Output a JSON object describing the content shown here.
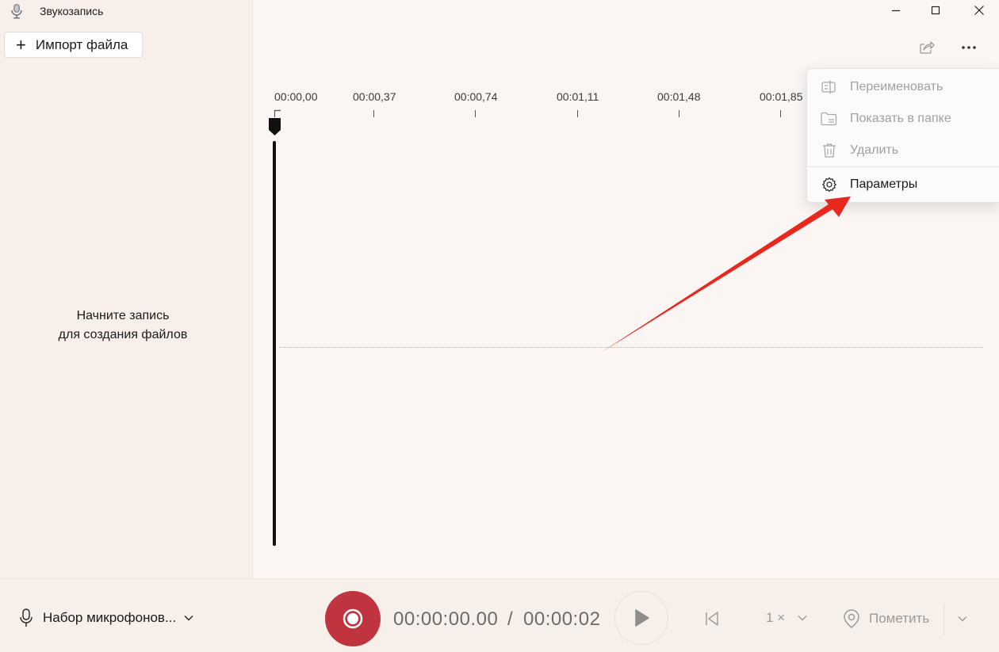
{
  "app": {
    "title": "Звукозапись"
  },
  "sidebar": {
    "import_label": "Импорт файла",
    "empty_line1": "Начните запись",
    "empty_line2": "для создания файлов"
  },
  "timeline": {
    "ticks": [
      "00:00,00",
      "00:00,37",
      "00:00,74",
      "00:01,11",
      "00:01,48",
      "00:01,85"
    ]
  },
  "menu": {
    "items": [
      {
        "label": "Переименовать",
        "icon": "rename-icon",
        "enabled": false
      },
      {
        "label": "Показать в папке",
        "icon": "folder-icon",
        "enabled": false
      },
      {
        "label": "Удалить",
        "icon": "trash-icon",
        "enabled": false
      },
      {
        "label": "Параметры",
        "icon": "gear-icon",
        "enabled": true
      }
    ]
  },
  "bottom": {
    "mic_label": "Набор микрофонов...",
    "time_current": "00:00:00.00",
    "time_separator": "/",
    "time_total": "00:00:02",
    "speed_label": "1 ×",
    "mark_label": "Пометить"
  },
  "colors": {
    "record": "#c0343f",
    "arrow": "#e8281e",
    "background": "#fbf6f3",
    "sidebar": "#f8efea"
  }
}
